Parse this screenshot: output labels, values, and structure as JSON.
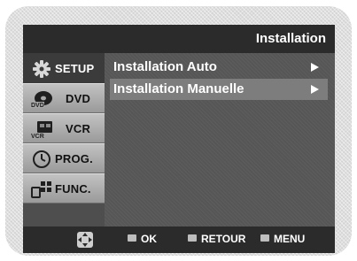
{
  "header": {
    "title": "Installation"
  },
  "sidebar": {
    "items": [
      {
        "label": "SETUP",
        "icon": "gear-icon"
      },
      {
        "label": "DVD",
        "icon": "dvd-disc-icon"
      },
      {
        "label": "VCR",
        "icon": "vcr-icon"
      },
      {
        "label": "PROG.",
        "icon": "clock-icon"
      },
      {
        "label": "FUNC.",
        "icon": "function-icon"
      }
    ]
  },
  "menu": {
    "items": [
      {
        "label": "Installation Auto"
      },
      {
        "label": "Installation Manuelle"
      }
    ]
  },
  "footer": {
    "ok_label": "OK",
    "back_label": "RETOUR",
    "menu_label": "MENU",
    "nav_icon": "directional-pad-icon"
  },
  "colors": {
    "screen_bg": "#4e4e4e",
    "bar_bg": "#2b2b2b",
    "selected_row": "#7d7d7d",
    "active_tab": "#3b3b3b"
  }
}
